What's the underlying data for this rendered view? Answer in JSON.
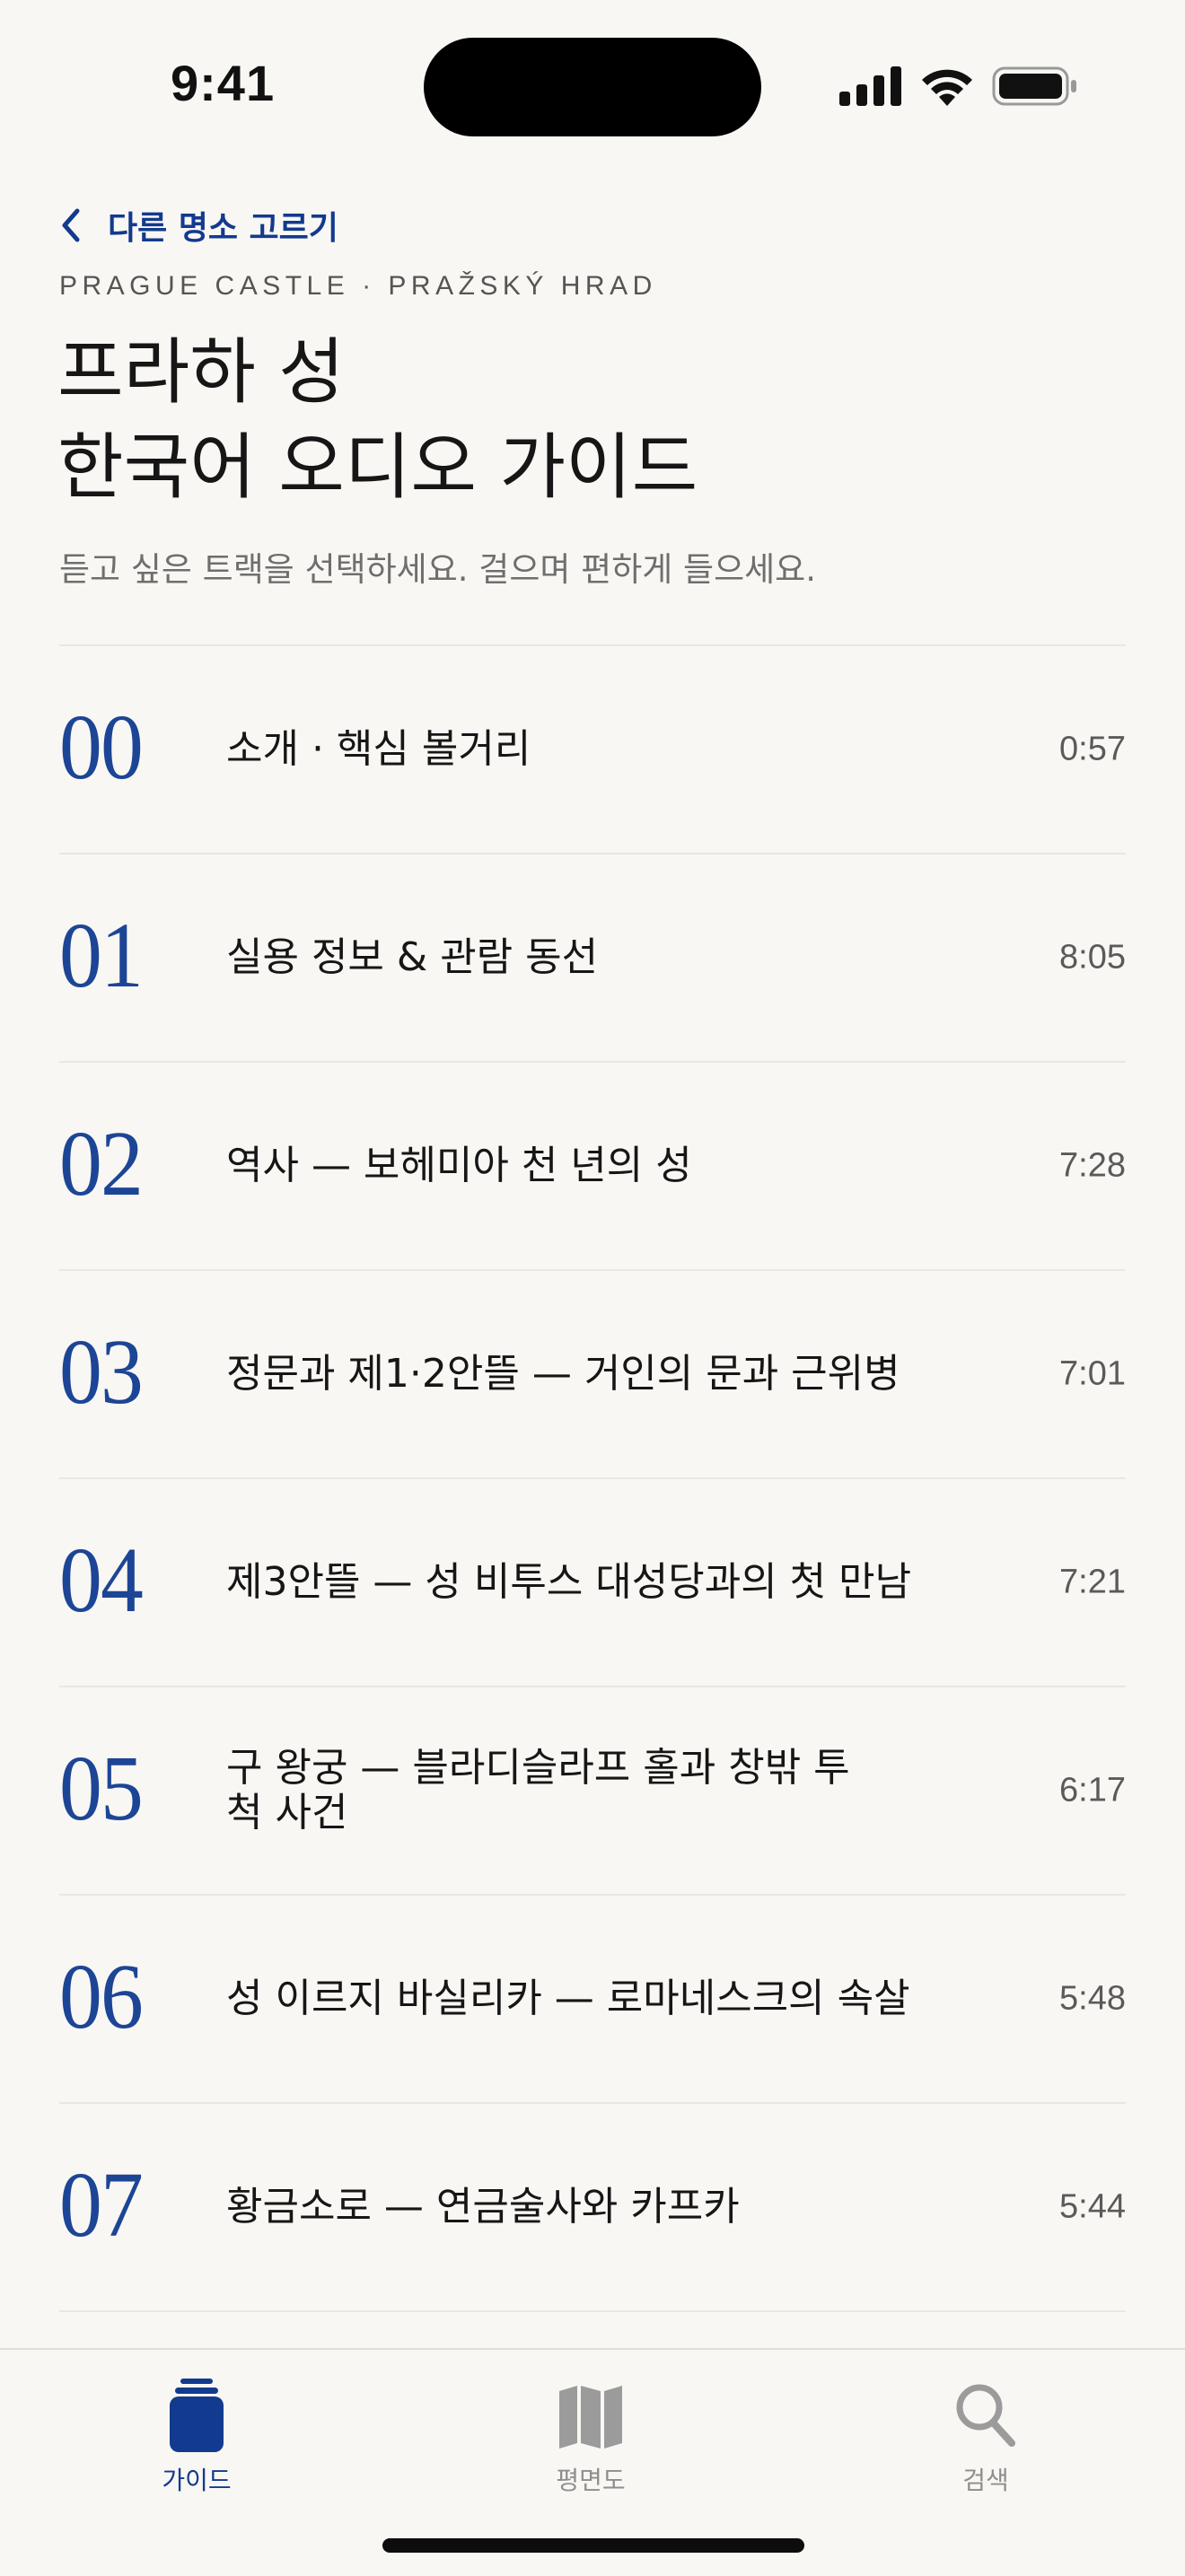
{
  "status_bar": {
    "time": "9:41"
  },
  "header": {
    "back_label": "다른 명소 고르기",
    "subtitle_en": "PRAGUE CASTLE · PRAŽSKÝ HRAD",
    "title_line1": "프라하 성",
    "title_line2": "한국어 오디오 가이드",
    "description": "듣고 싶은 트랙을 선택하세요. 걸으며 편하게 들으세요."
  },
  "tracks": [
    {
      "num": "00",
      "title": "소개 · 핵심 볼거리",
      "duration": "0:57"
    },
    {
      "num": "01",
      "title": "실용 정보 & 관람 동선",
      "duration": "8:05"
    },
    {
      "num": "02",
      "title": "역사 — 보헤미아 천 년의 성",
      "duration": "7:28"
    },
    {
      "num": "03",
      "title": "정문과 제1·2안뜰 — 거인의 문과 근위병",
      "duration": "7:01"
    },
    {
      "num": "04",
      "title": "제3안뜰 — 성 비투스 대성당과의 첫 만남",
      "duration": "7:21"
    },
    {
      "num": "05",
      "title": "구 왕궁 — 블라디슬라프 홀과 창밖 투척 사건",
      "duration": "6:17"
    },
    {
      "num": "06",
      "title": "성 이르지 바실리카 — 로마네스크의 속살",
      "duration": "5:48"
    },
    {
      "num": "07",
      "title": "황금소로 — 연금술사와 카프카",
      "duration": "5:44"
    }
  ],
  "tab_bar": {
    "guide_label": "가이드",
    "map_label": "평면도",
    "search_label": "검색",
    "active_tab": "guide"
  },
  "colors": {
    "accent": "#123a8e",
    "background": "#f9f7f3",
    "inactive": "#8e8e8e"
  }
}
